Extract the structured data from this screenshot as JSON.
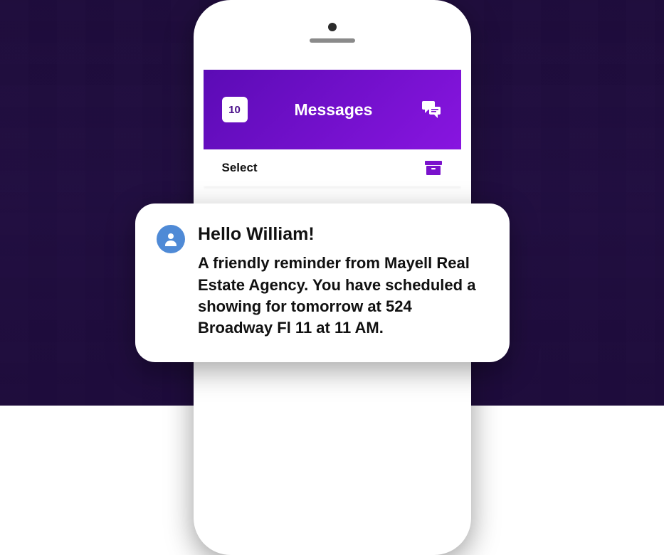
{
  "header": {
    "badge_count": "10",
    "title": "Messages"
  },
  "toolbar": {
    "select_label": "Select"
  },
  "message": {
    "greeting": "Hello William!",
    "body": "A friendly reminder from Mayell Real Estate Agency. You have scheduled a showing for tomorrow at 524 Broadway Fl 11 at 11 AM."
  },
  "colors": {
    "accent_start": "#5b0bb5",
    "accent_end": "#8815e0",
    "avatar": "#4f8ad6"
  }
}
